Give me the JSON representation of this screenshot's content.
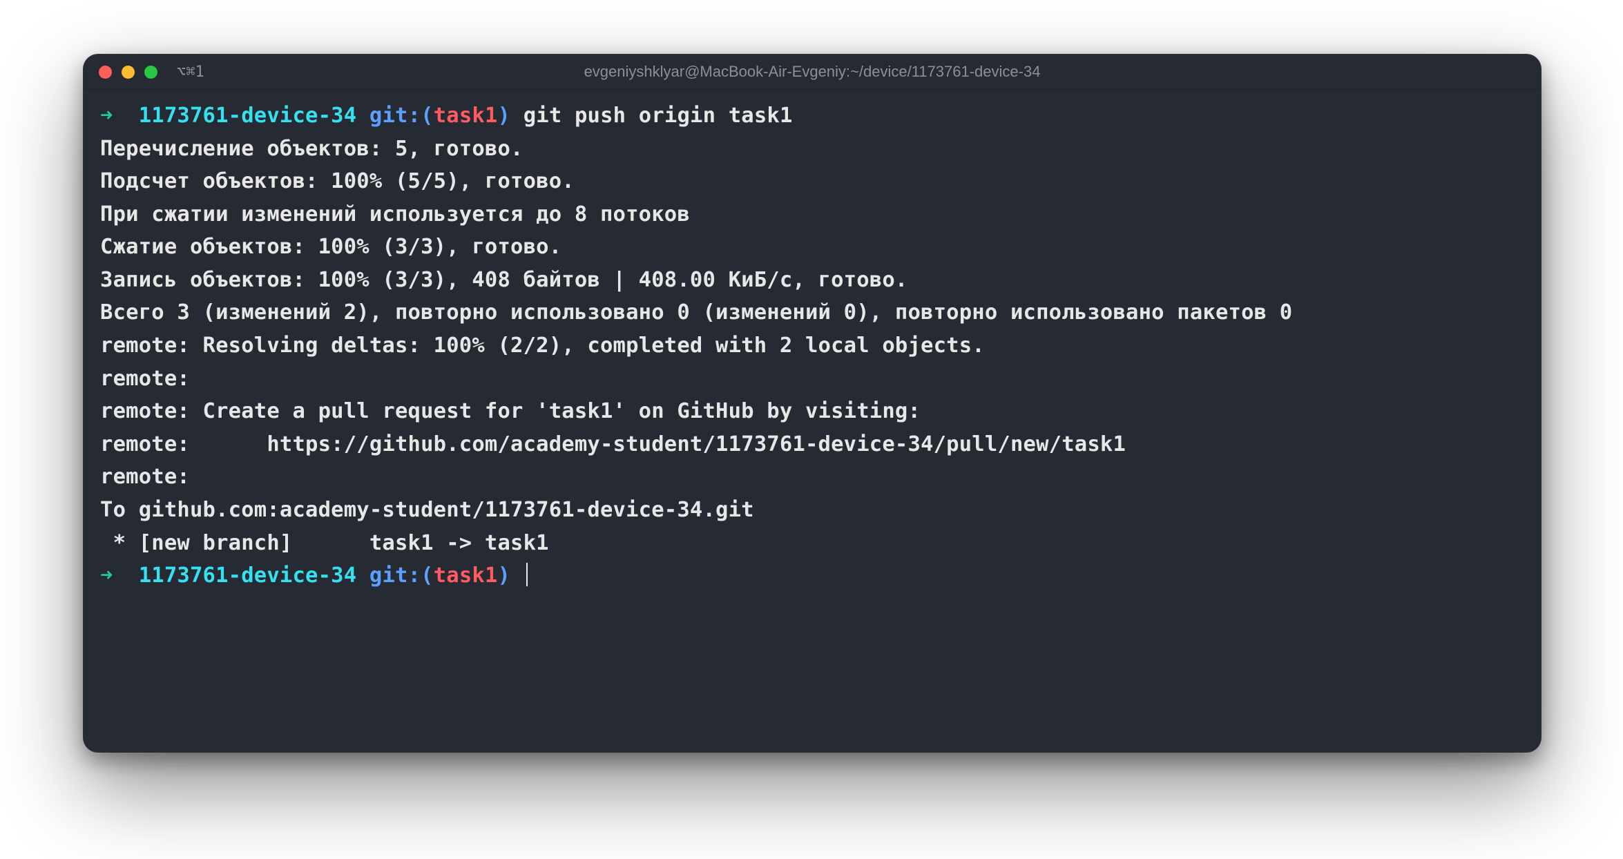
{
  "window": {
    "tab_icon": "⌥⌘1",
    "title": "evgeniyshklyar@MacBook-Air-Evgeniy:~/device/1173761-device-34"
  },
  "colors": {
    "close": "#ff5f57",
    "minimize": "#febc2e",
    "zoom": "#28c840"
  },
  "prompt1": {
    "arrow": "➜",
    "dir": "1173761-device-34",
    "git_prefix": "git:(",
    "branch": "task1",
    "git_suffix": ")",
    "command": "git push origin task1"
  },
  "output": {
    "l1": "Перечисление объектов: 5, готово.",
    "l2": "Подсчет объектов: 100% (5/5), готово.",
    "l3": "При сжатии изменений используется до 8 потоков",
    "l4": "Сжатие объектов: 100% (3/3), готово.",
    "l5": "Запись объектов: 100% (3/3), 408 байтов | 408.00 КиБ/с, готово.",
    "l6": "Всего 3 (изменений 2), повторно использовано 0 (изменений 0), повторно использовано пакетов 0",
    "l7": "remote: Resolving deltas: 100% (2/2), completed with 2 local objects.",
    "l8": "remote:",
    "l9": "remote: Create a pull request for 'task1' on GitHub by visiting:",
    "l10": "remote:      https://github.com/academy-student/1173761-device-34/pull/new/task1",
    "l11": "remote:",
    "l12": "To github.com:academy-student/1173761-device-34.git",
    "l13": " * [new branch]      task1 -> task1"
  },
  "prompt2": {
    "arrow": "➜",
    "dir": "1173761-device-34",
    "git_prefix": "git:(",
    "branch": "task1",
    "git_suffix": ")"
  }
}
